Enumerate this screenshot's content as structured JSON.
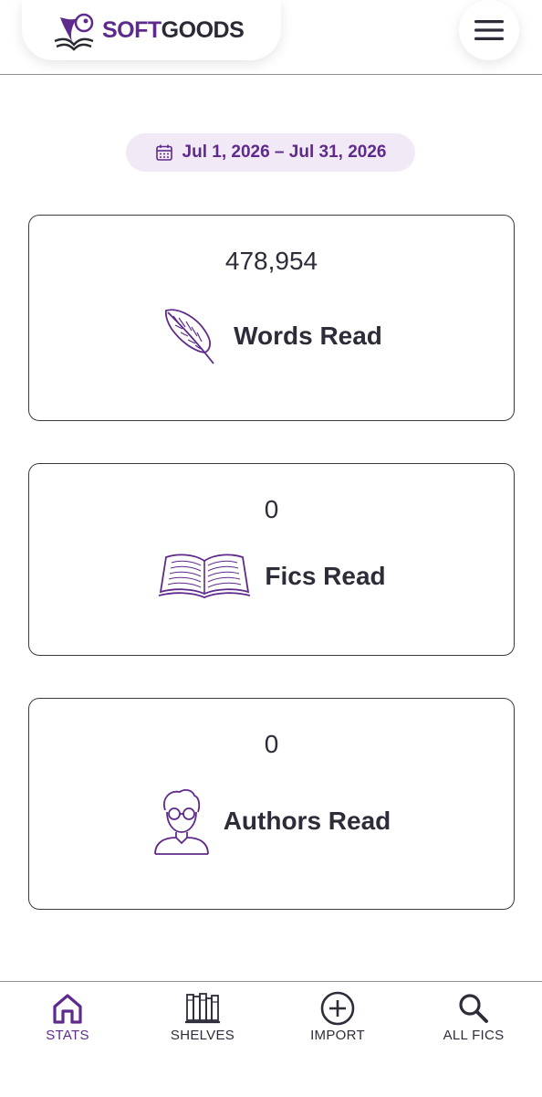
{
  "header": {
    "logo_soft": "SOFT",
    "logo_goods": "GOODS",
    "logo_icon": "book-quill-icon",
    "menu_icon": "hamburger-menu-icon"
  },
  "date_range": {
    "icon": "calendar-icon",
    "label": "Jul 1, 2026 – Jul 31, 2026"
  },
  "stats": [
    {
      "value": "478,954",
      "label": "Words Read",
      "icon": "quill-feather-icon"
    },
    {
      "value": "0",
      "label": "Fics Read",
      "icon": "open-book-icon"
    },
    {
      "value": "0",
      "label": "Authors Read",
      "icon": "person-glasses-icon"
    }
  ],
  "nav": {
    "items": [
      {
        "label": "STATS",
        "icon": "home-icon",
        "active": true
      },
      {
        "label": "SHELVES",
        "icon": "bookshelf-icon",
        "active": false
      },
      {
        "label": "IMPORT",
        "icon": "plus-circle-icon",
        "active": false
      },
      {
        "label": "ALL FICS",
        "icon": "search-icon",
        "active": false
      }
    ]
  },
  "colors": {
    "accent": "#5e2a8c",
    "accent_light": "#f1eaf6",
    "text": "#2d2d3a",
    "border": "#3a3a42"
  }
}
